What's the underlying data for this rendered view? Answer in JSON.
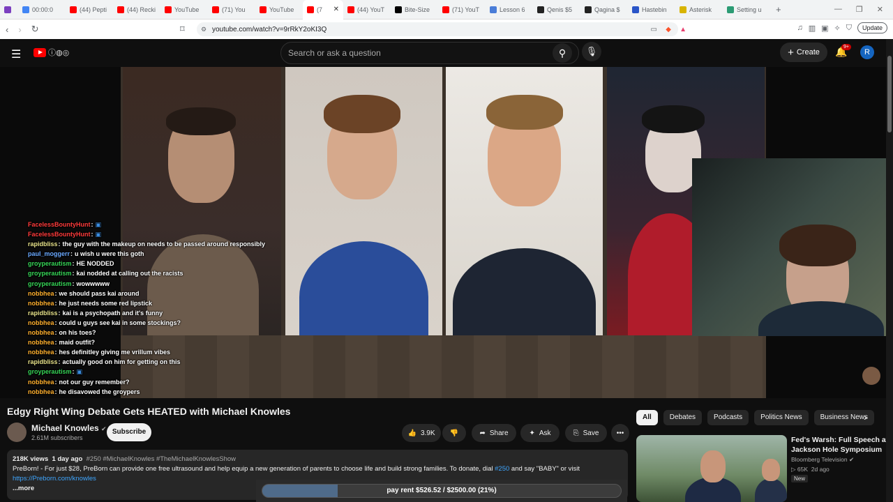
{
  "browser": {
    "tabs": [
      {
        "label": "",
        "color": "#7b3fbf"
      },
      {
        "label": "00:00:0",
        "color": "#4285f4"
      },
      {
        "label": "(44) Pepti",
        "color": "#ff0000"
      },
      {
        "label": "(44) Recki",
        "color": "#ff0000"
      },
      {
        "label": "YouTube",
        "color": "#ff0000"
      },
      {
        "label": "(71) You",
        "color": "#ff0000"
      },
      {
        "label": "YouTube",
        "color": "#ff0000"
      },
      {
        "label": "(7",
        "color": "#ff0000"
      },
      {
        "label": "(44) YouT",
        "color": "#ff0000"
      },
      {
        "label": "Bite-Size",
        "color": "#000000"
      },
      {
        "label": "(71) YouT",
        "color": "#ff0000"
      },
      {
        "label": "Lesson 6",
        "color": "#4a7dd8"
      },
      {
        "label": "Qenis $5",
        "color": "#222222"
      },
      {
        "label": "Qagina $",
        "color": "#222222"
      },
      {
        "label": "Hastebin",
        "color": "#2a55c8"
      },
      {
        "label": "Asterisk",
        "color": "#d8b400"
      },
      {
        "label": "Setting u",
        "color": "#2b9b74"
      }
    ],
    "new_tab": "+",
    "url": "youtube.com/watch?v=9rRkY2oKI3Q",
    "update_label": "Update"
  },
  "header": {
    "search_placeholder": "Search or ask a question",
    "create_label": "Create",
    "notif_count": "9+",
    "avatar_letter": "R"
  },
  "chat": [
    {
      "user": "FacelessBountyHunt",
      "msg": "",
      "color": "#ff3b3b"
    },
    {
      "user": "FacelessBountyHunt",
      "msg": "",
      "color": "#ff3b3b"
    },
    {
      "user": "rapidbliss",
      "msg": "the guy with the makeup on needs to be passed around responsibly",
      "color": "#e7e28a"
    },
    {
      "user": "paul_moggerr",
      "msg": "u wish u were this goth",
      "color": "#6aa9ff"
    },
    {
      "user": "groyperautism",
      "msg": "HE NODDED",
      "color": "#36d657"
    },
    {
      "user": "groyperautism",
      "msg": "kai nodded at calling out the racists",
      "color": "#36d657"
    },
    {
      "user": "groyperautism",
      "msg": "wowwwww",
      "color": "#36d657"
    },
    {
      "user": "nobbhea",
      "msg": "we should pass kai around",
      "color": "#ffb02e"
    },
    {
      "user": "nobbhea",
      "msg": "he just needs some red lipstick",
      "color": "#ffb02e"
    },
    {
      "user": "rapidbliss",
      "msg": "kai is a psychopath and it's funny",
      "color": "#e7e28a"
    },
    {
      "user": "nobbhea",
      "msg": "could u guys see kai in some stockings?",
      "color": "#ffb02e"
    },
    {
      "user": "nobbhea",
      "msg": "on his toes?",
      "color": "#ffb02e"
    },
    {
      "user": "nobbhea",
      "msg": "maid outfit?",
      "color": "#ffb02e"
    },
    {
      "user": "nobbhea",
      "msg": "hes definitley giving me vrillum vibes",
      "color": "#ffb02e"
    },
    {
      "user": "rapidbliss",
      "msg": "actually good on him for getting on this",
      "color": "#e7e28a"
    },
    {
      "user": "groyperautism",
      "msg": "",
      "color": "#36d657"
    },
    {
      "user": "nobbhea",
      "msg": "not our guy remember?",
      "color": "#ffb02e"
    },
    {
      "user": "nobbhea",
      "msg": "he disavowed the groypers",
      "color": "#ffb02e"
    },
    {
      "user": "nobbhea",
      "msg": "",
      "color": "#ffb02e"
    }
  ],
  "video": {
    "title": "Edgy Right Wing Debate Gets HEATED with Michael Knowles",
    "channel": "Michael Knowles",
    "subscribers": "2.61M subscribers",
    "subscribe_label": "Subscribe",
    "likes": "3.9K",
    "share_label": "Share",
    "ask_label": "Ask",
    "save_label": "Save",
    "views": "218K views",
    "age": "1 day ago",
    "tags": "#250 #MichaelKnowles #TheMichaelKnowlesShow",
    "desc_text_1": "PreBorn! - For just $28, PreBorn can provide one free ultrasound and help equip a new generation of parents to choose life and build strong families. To donate, dial ",
    "desc_link_1": "#250",
    "desc_text_2": " and say \"BABY\" or visit",
    "desc_link_2": "https://Preborn.com/knowles",
    "more_label": "...more"
  },
  "overlay": {
    "pay_text": "pay rent $526.52 / $2500.00 (21%)",
    "pay_progress": 0.21
  },
  "sidebar": {
    "chips": [
      {
        "label": "All",
        "selected": true
      },
      {
        "label": "Debates",
        "selected": false
      },
      {
        "label": "Podcasts",
        "selected": false
      },
      {
        "label": "Politics News",
        "selected": false
      },
      {
        "label": "Business News",
        "selected": false
      }
    ],
    "rec": {
      "title": "Fed's Warsh: Full Speech at Jackson Hole Symposium",
      "channel": "Bloomberg Television",
      "views": "65K",
      "age": "2d ago",
      "badge": "New"
    }
  }
}
